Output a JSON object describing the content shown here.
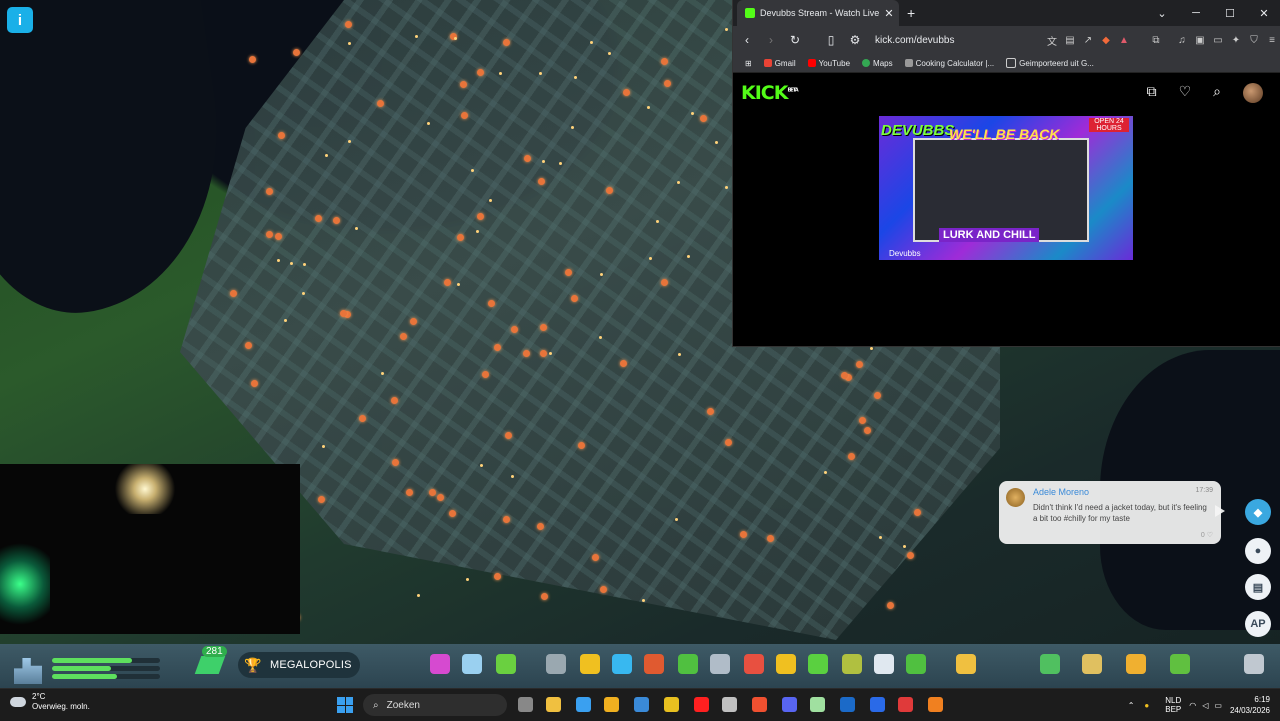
{
  "browser": {
    "tab_title": "Devubbs Stream - Watch Live on",
    "url": "kick.com/devubbs",
    "bookmarks": [
      "Gmail",
      "YouTube",
      "Maps",
      "Cooking Calculator |...",
      "Geimporteerd uit G..."
    ],
    "kick_logo": "KICK",
    "kick_logo_sup": "BETA",
    "thumbnail": {
      "brand": "DEVUBBS",
      "headline": "WE'LL BE BACK",
      "banner": "LURK AND CHILL",
      "corner": "OPEN 24 HOURS",
      "footer": "Devubbs"
    }
  },
  "chat": {
    "name": "Adele Moreno",
    "time": "17:39",
    "message": "Didn't think I'd need a jacket today, but it's feeling a bit too #chilly for my taste",
    "likes": "0"
  },
  "side_buttons": {
    "ap_label": "AP"
  },
  "game_toolbar": {
    "level_badge": "281",
    "milestone": "MEGALOPOLIS",
    "bars": [
      0.74,
      0.55,
      0.6
    ],
    "icon_colors": [
      "#d64ad0",
      "#9ad0f0",
      "#6ad040",
      "#9aa8b0",
      "#f0c020",
      "#38b8f0",
      "#e05a30",
      "#50c040",
      "#b0bcc8",
      "#e85040",
      "#f0c020",
      "#5ad040",
      "#b0c040",
      "#e0e8f0",
      "#50c040",
      "#f0c040",
      "#50c060",
      "#e0c060",
      "#f0b030",
      "#60c040",
      "#c0c8d0"
    ]
  },
  "taskbar": {
    "weather_temp": "2°C",
    "weather_desc": "Overwieg. moln.",
    "search_placeholder": "Zoeken",
    "lang_top": "NLD",
    "lang_bottom": "BEP",
    "time": "6:19",
    "date": "24/03/2026"
  },
  "colors": {
    "kick_green": "#53fc18",
    "chat_name": "#3a8ad8",
    "taskbar_bg": "#1c1c1c"
  }
}
